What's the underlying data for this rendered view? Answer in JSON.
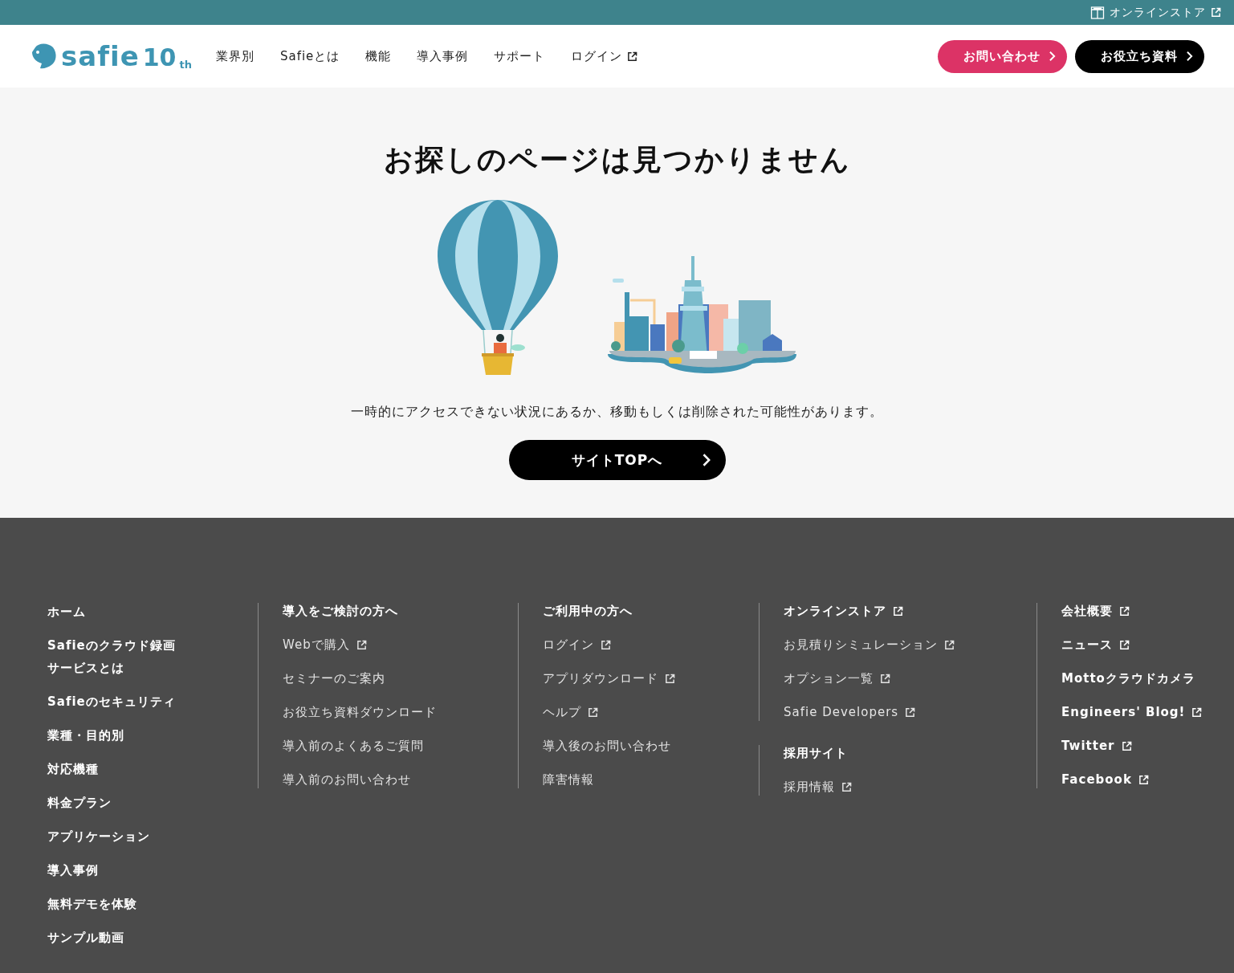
{
  "topbar": {
    "store_link": "オンラインストア"
  },
  "header": {
    "logo": {
      "word": "safie",
      "number": "10",
      "suffix": "th"
    },
    "nav": [
      {
        "label": "業界別",
        "external": false
      },
      {
        "label": "Safieとは",
        "external": false
      },
      {
        "label": "機能",
        "external": false
      },
      {
        "label": "導入事例",
        "external": false
      },
      {
        "label": "サポート",
        "external": false
      },
      {
        "label": "ログイン",
        "external": true
      }
    ],
    "buttons": [
      {
        "label": "お問い合わせ",
        "kind": "primary"
      },
      {
        "label": "お役立ち資料",
        "kind": "dark"
      }
    ]
  },
  "main": {
    "title": "お探しのページは見つかりません",
    "message": "一時的にアクセスできない状況にあるか、移動もしくは削除された可能性があります。",
    "button": "サイトTOPへ"
  },
  "footer": {
    "columns": [
      {
        "groups": [
          {
            "divider": false,
            "items": [
              {
                "label": "ホーム",
                "kind": "heading",
                "external": false
              },
              {
                "label": "Safieのクラウド録画サービスとは",
                "kind": "heading",
                "external": false
              },
              {
                "label": "Safieのセキュリティ",
                "kind": "heading",
                "external": false
              },
              {
                "label": "業種・目的別",
                "kind": "heading",
                "external": false
              },
              {
                "label": "対応機種",
                "kind": "heading",
                "external": false
              },
              {
                "label": "料金プラン",
                "kind": "heading",
                "external": false
              },
              {
                "label": "アプリケーション",
                "kind": "heading",
                "external": false
              },
              {
                "label": "導入事例",
                "kind": "heading",
                "external": false
              },
              {
                "label": "無料デモを体験",
                "kind": "heading",
                "external": false
              },
              {
                "label": "サンプル動画",
                "kind": "heading",
                "external": false
              }
            ]
          }
        ]
      },
      {
        "groups": [
          {
            "divider": true,
            "items": [
              {
                "label": "導入をご検討の方へ",
                "kind": "heading",
                "external": false
              },
              {
                "label": "Webで購入",
                "kind": "link",
                "external": true
              },
              {
                "label": "セミナーのご案内",
                "kind": "link",
                "external": false
              },
              {
                "label": "お役立ち資料ダウンロード",
                "kind": "link",
                "external": false
              },
              {
                "label": "導入前のよくあるご質問",
                "kind": "link",
                "external": false
              },
              {
                "label": "導入前のお問い合わせ",
                "kind": "link",
                "external": false
              }
            ]
          }
        ]
      },
      {
        "groups": [
          {
            "divider": true,
            "items": [
              {
                "label": "ご利用中の方へ",
                "kind": "heading",
                "external": false
              },
              {
                "label": "ログイン",
                "kind": "link",
                "external": true
              },
              {
                "label": "アプリダウンロード",
                "kind": "link",
                "external": true
              },
              {
                "label": "ヘルプ",
                "kind": "link",
                "external": true
              },
              {
                "label": "導入後のお問い合わせ",
                "kind": "link",
                "external": false
              },
              {
                "label": "障害情報",
                "kind": "link",
                "external": false
              }
            ]
          }
        ]
      },
      {
        "groups": [
          {
            "divider": true,
            "items": [
              {
                "label": "オンラインストア",
                "kind": "heading",
                "external": true
              },
              {
                "label": "お見積りシミュレーション",
                "kind": "link",
                "external": true
              },
              {
                "label": "オプション一覧",
                "kind": "link",
                "external": true
              },
              {
                "label": "Safie Developers",
                "kind": "link",
                "external": true
              }
            ]
          },
          {
            "divider": true,
            "items": [
              {
                "label": "採用サイト",
                "kind": "heading",
                "external": false
              },
              {
                "label": "採用情報",
                "kind": "link",
                "external": true
              }
            ]
          }
        ]
      },
      {
        "groups": [
          {
            "divider": true,
            "items": [
              {
                "label": "会社概要",
                "kind": "heading",
                "external": true
              },
              {
                "label": "ニュース",
                "kind": "heading",
                "external": true
              },
              {
                "label": "Mottoクラウドカメラ",
                "kind": "heading",
                "external": false
              },
              {
                "label": "Engineers' Blog!",
                "kind": "heading",
                "external": true
              },
              {
                "label": "Twitter",
                "kind": "heading",
                "external": true
              },
              {
                "label": "Facebook",
                "kind": "heading",
                "external": true
              }
            ]
          }
        ]
      }
    ]
  }
}
